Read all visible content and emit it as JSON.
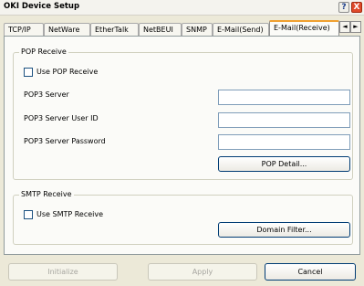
{
  "window": {
    "title": "OKI Device Setup",
    "help_label": "?",
    "close_label": "X"
  },
  "tabs": [
    {
      "label": "TCP/IP"
    },
    {
      "label": "NetWare"
    },
    {
      "label": "EtherTalk"
    },
    {
      "label": "NetBEUI"
    },
    {
      "label": "SNMP"
    },
    {
      "label": "E-Mail(Send)"
    },
    {
      "label": "E-Mail(Receive)",
      "active": true
    }
  ],
  "tab_scroll": {
    "left": "◄",
    "right": "►"
  },
  "pop_receive": {
    "legend": "POP Receive",
    "use_label": "Use POP Receive",
    "use_checked": false,
    "server_label": "POP3 Server",
    "server_value": "",
    "user_label": "POP3 Server User ID",
    "user_value": "",
    "password_label": "POP3 Server Password",
    "password_value": "",
    "detail_button": "POP Detail..."
  },
  "smtp_receive": {
    "legend": "SMTP Receive",
    "use_label": "Use SMTP Receive",
    "use_checked": false,
    "domain_button": "Domain Filter..."
  },
  "footer": {
    "initialize": "Initialize",
    "apply": "Apply",
    "cancel": "Cancel"
  }
}
